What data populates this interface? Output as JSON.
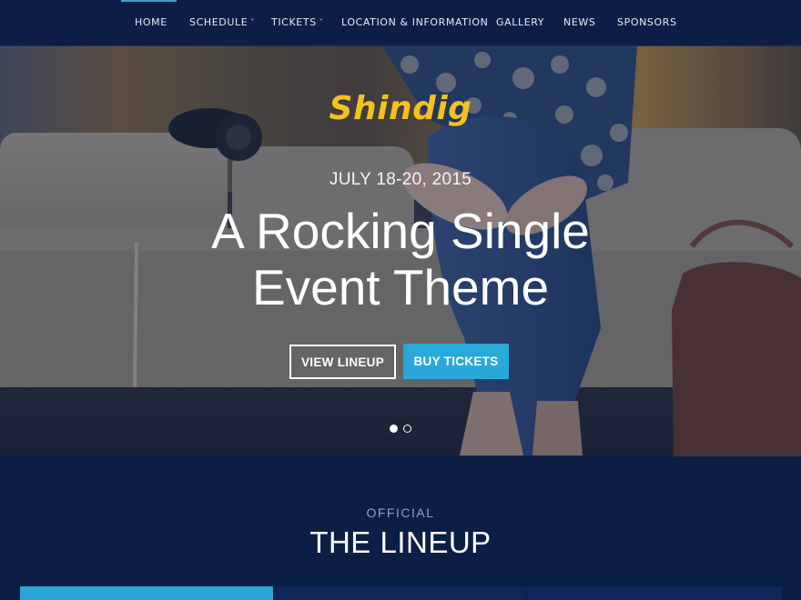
{
  "nav": {
    "items": [
      {
        "label": "HOME",
        "has_dropdown": false
      },
      {
        "label": "SCHEDULE",
        "has_dropdown": true
      },
      {
        "label": "TICKETS",
        "has_dropdown": true
      },
      {
        "label": "LOCATION & INFORMATION",
        "has_dropdown": false
      },
      {
        "label": "GALLERY",
        "has_dropdown": false
      },
      {
        "label": "NEWS",
        "has_dropdown": false
      },
      {
        "label": "SPONSORS",
        "has_dropdown": false
      }
    ],
    "active_index": 0,
    "dropdown_glyph": "˅"
  },
  "hero": {
    "logo": "Shindig",
    "dates": "JULY 18-20, 2015",
    "headline_line1": "A Rocking Single",
    "headline_line2": "Event Theme",
    "buttons": {
      "lineup": "VIEW LINEUP",
      "tickets": "BUY TICKETS"
    },
    "slider": {
      "slides": 2,
      "active": 1
    }
  },
  "lineup": {
    "eyebrow": "OFFICIAL",
    "title": "THE LINEUP"
  },
  "colors": {
    "navy": "#0b1e45",
    "accent": "#29a9d9",
    "logo": "#f2c21f"
  },
  "icons": {
    "chevron": "chevron-down-icon"
  }
}
